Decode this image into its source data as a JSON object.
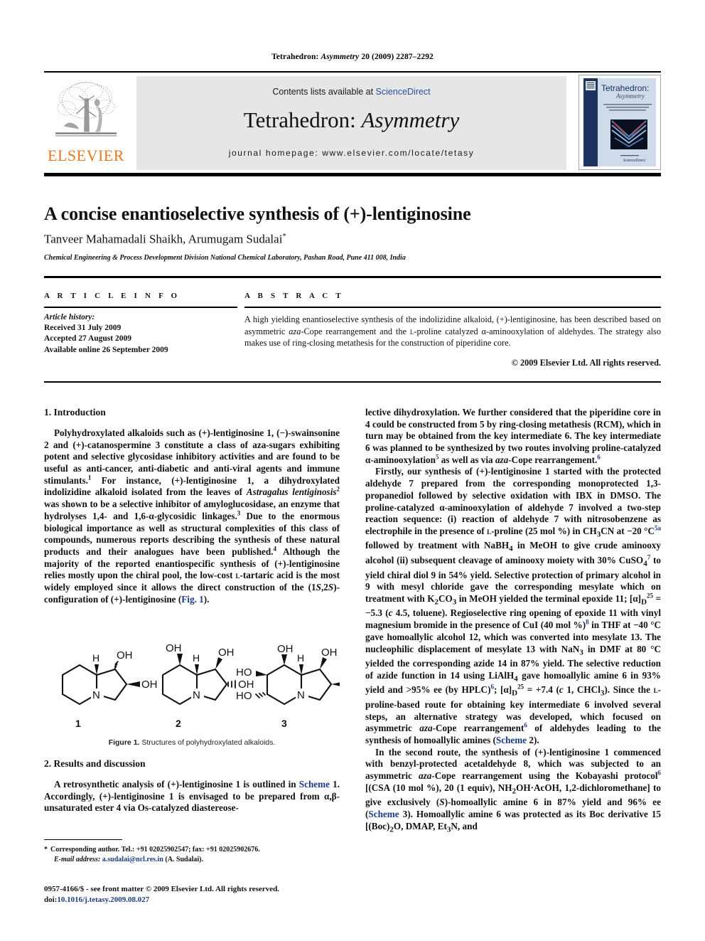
{
  "running_head": {
    "journal": "Tetrahedron:",
    "journal_italic": "Asymmetry",
    "citation": "20 (2009) 2287–2292"
  },
  "masthead": {
    "publisher_name": "ELSEVIER",
    "contents_prefix": "Contents lists available at ",
    "contents_link": "ScienceDirect",
    "journal_title_main": "Tetrahedron: ",
    "journal_title_italic": "Asymmetry",
    "homepage": "journal homepage: www.elsevier.com/locate/tetasy",
    "cover_title_main": "Tetrahedron:",
    "cover_title_sub": "Asymmetry",
    "cover_footer": "ScienceDirect"
  },
  "article": {
    "title": "A concise enantioselective synthesis of (+)-lentiginosine",
    "authors": "Tanveer Mahamadali Shaikh, Arumugam Sudalai",
    "author_marker": "*",
    "affiliation": "Chemical Engineering & Process Development Division National Chemical Laboratory, Pashan Road, Pune 411 008, India"
  },
  "article_info": {
    "heading": "A R T I C L E   I N F O",
    "history_label": "Article history:",
    "received": "Received 31 July 2009",
    "accepted": "Accepted 27 August 2009",
    "available": "Available online 26 September 2009"
  },
  "abstract": {
    "heading": "A B S T R A C T",
    "text_part1": "A high yielding enantioselective synthesis of the indolizidine alkaloid, (+)-lentiginosine, has been described based on asymmetric ",
    "text_italic1": "aza",
    "text_part2": "-Cope rearrangement and the ",
    "text_sc1": "l",
    "text_part3": "-proline catalyzed α-aminooxylation of aldehydes. The strategy also makes use of ring-closing metathesis for the construction of piperidine core.",
    "copyright": "© 2009 Elsevier Ltd. All rights reserved."
  },
  "sections": {
    "intro_heading": "1. Introduction",
    "results_heading": "2. Results and discussion"
  },
  "body": {
    "left_p1": "Polyhydroxylated alkaloids such as (+)-lentiginosine 1, (−)-swainsonine 2 and (+)-catanospermine 3 constitute a class of aza-sugars exhibiting potent and selective glycosidase inhibitory activities and are found to be useful as anti-cancer, anti-diabetic and anti-viral agents and immune stimulants.1 For instance, (+)-lentiginosine 1, a dihydroxylated indolizidine alkaloid isolated from the leaves of Astragalus lentiginosis2 was shown to be a selective inhibitor of amyloglucosidase, an enzyme that hydrolyses 1,4- and 1,6-α-glycosidic linkages.3 Due to the enormous biological importance as well as structural complexities of this class of compounds, numerous reports describing the synthesis of these natural products and their analogues have been published.4 Although the majority of the reported enantiospecific synthesis of (+)-lentiginosine relies mostly upon the chiral pool, the low-cost l-tartaric acid is the most widely employed since it allows the direct construction of the (1S,2S)-configuration of (+)-lentiginosine (Fig. 1).",
    "left_p2": "A retrosynthetic analysis of (+)-lentiginosine 1 is outlined in Scheme 1. Accordingly, (+)-lentiginosine 1 is envisaged to be prepared from α,β-unsaturated ester 4 via Os-catalyzed diastereoselective dihydroxylation.",
    "right_p1": "lective dihydroxylation. We further considered that the piperidine core in 4 could be constructed from 5 by ring-closing metathesis (RCM), which in turn may be obtained from the key intermediate 6. The key intermediate 6 was planned to be synthesized by two routes involving proline-catalyzed α-aminooxylation5 as well as via aza-Cope rearrangement.6",
    "right_p2": "Firstly, our synthesis of (+)-lentiginosine 1 started with the protected aldehyde 7 prepared from the corresponding monoprotected 1,3-propanediol followed by selective oxidation with IBX in DMSO. The proline-catalyzed α-aminooxylation of aldehyde 7 involved a two-step reaction sequence: (i) reaction of aldehyde 7 with nitrosobenzene as electrophile in the presence of l-proline (25 mol %) in CH3CN at −20 °C5a followed by treatment with NaBH4 in MeOH to give crude aminooxy alcohol (ii) subsequent cleavage of aminooxy moiety with 30% CuSO47 to yield chiral diol 9 in 54% yield. Selective protection of primary alcohol in 9 with mesyl chloride gave the corresponding mesylate which on treatment with K2CO3 in MeOH yielded the terminal epoxide 11; [α]D25 = −5.3 (c 4.5, toluene). Regioselective ring opening of epoxide 11 with vinyl magnesium bromide in the presence of CuI (40 mol %)8 in THF at −40 °C gave homoallylic alcohol 12, which was converted into mesylate 13. The nucleophilic displacement of mesylate 13 with NaN3 in DMF at 80 °C yielded the corresponding azide 14 in 87% yield. The selective reduction of azide function in 14 using LiAlH4 gave homoallylic amine 6 in 93% yield and >95% ee (by HPLC)6; [α]D25 = +7.4 (c 1, CHCl3). Since the l-proline-based route for obtaining key intermediate 6 involved several steps, an alternative strategy was developed, which focused on asymmetric aza-Cope rearrangement6 of aldehydes leading to the synthesis of homoallylic amines (Scheme 2).",
    "right_p3": "In the second route, the synthesis of (+)-lentiginosine 1 commenced with benzyl-protected acetaldehyde 8, which was subjected to an asymmetric aza-Cope rearrangement using the Kobayashi protocol6 [(CSA (10 mol %), 20 (1 equiv), NH2OH·AcOH, 1,2-dichloromethane] to give exclusively (S)-homoallylic amine 6 in 87% yield and 96% ee (Scheme 3). Homoallylic amine 6 was protected as its Boc derivative 15 [(Boc)2O, DMAP, Et3N, and"
  },
  "figure": {
    "caption_label": "Figure 1.",
    "caption_text": " Structures of polyhydroxylated alkaloids.",
    "structures": [
      {
        "number": "1",
        "name": "lentiginosine"
      },
      {
        "number": "2",
        "name": "swainsonine"
      },
      {
        "number": "3",
        "name": "catanospermine"
      }
    ],
    "labels": {
      "OH": "OH",
      "HO": "HO",
      "N": "N",
      "H": "H"
    }
  },
  "footnote": {
    "marker": "*",
    "corresponding": "Corresponding author. Tel.: +91 02025902547; fax: +91 02025902676.",
    "email_label": "E-mail address:",
    "email": "a.sudalai@ncl.res.in",
    "email_owner": "(A. Sudalai)."
  },
  "imprint": {
    "line1": "0957-4166/$ - see front matter © 2009 Elsevier Ltd. All rights reserved.",
    "doi_label": "doi:",
    "doi_value": "10.1016/j.tetasy.2009.08.027"
  },
  "colors": {
    "link": "#1b3a86",
    "elsevier_orange": "#E87722",
    "sciencedirect_blue": "#2b4f9e",
    "band_grey": "#e6e6e6",
    "cover_navy": "#1d3461"
  }
}
